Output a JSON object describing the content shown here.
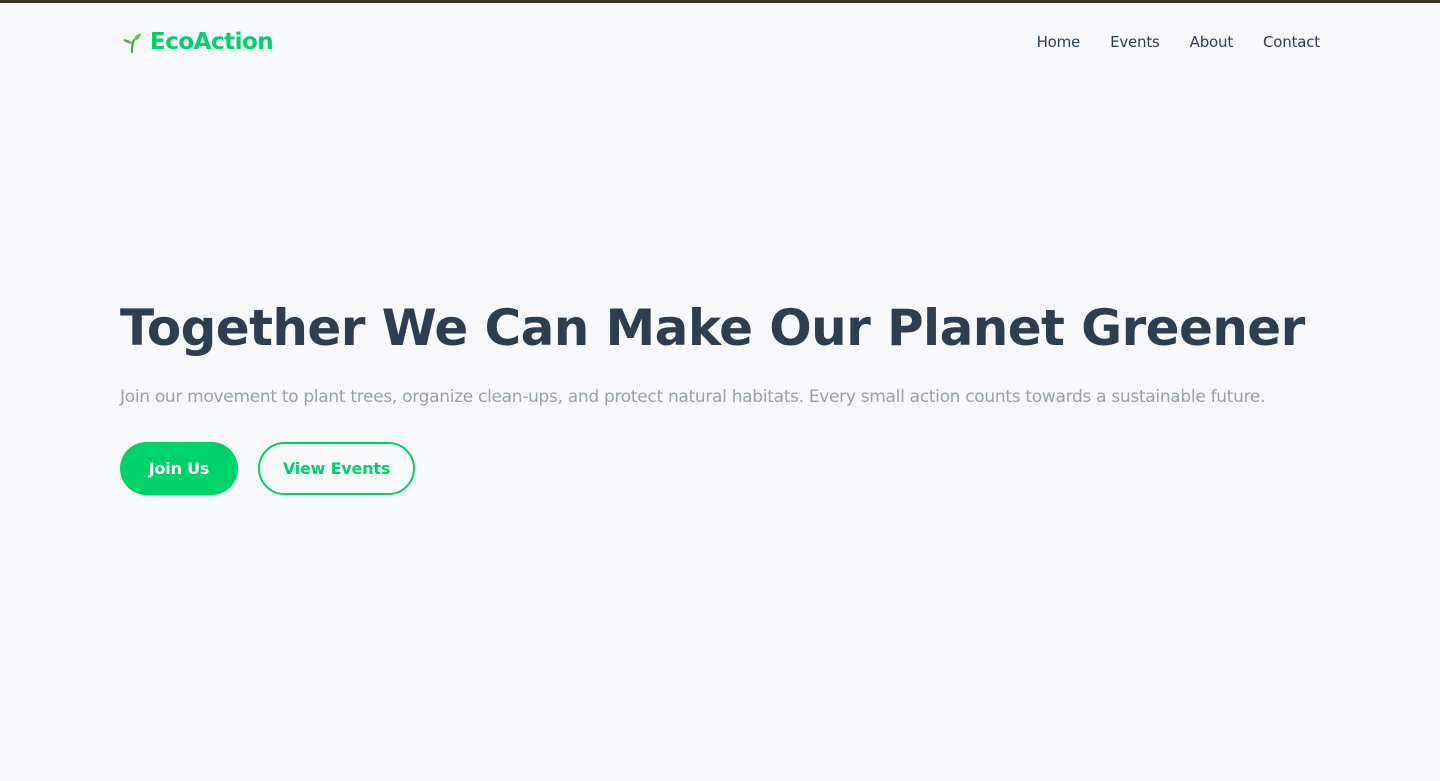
{
  "brand": {
    "name": "EcoAction",
    "icon": "seedling-icon",
    "color": "#00d26a"
  },
  "nav": {
    "items": [
      {
        "label": "Home"
      },
      {
        "label": "Events"
      },
      {
        "label": "About"
      },
      {
        "label": "Contact"
      }
    ]
  },
  "hero": {
    "title": "Together We Can Make Our Planet Greener",
    "subtitle": "Join our movement to plant trees, organize clean-ups, and protect natural habitats. Every small action counts towards a sustainable future.",
    "primary_button": "Join Us",
    "secondary_button": "View Events"
  },
  "colors": {
    "accent": "#00d26a",
    "heading": "#2c3e50",
    "muted": "#95a5a6",
    "background": "#f7f9fb"
  }
}
